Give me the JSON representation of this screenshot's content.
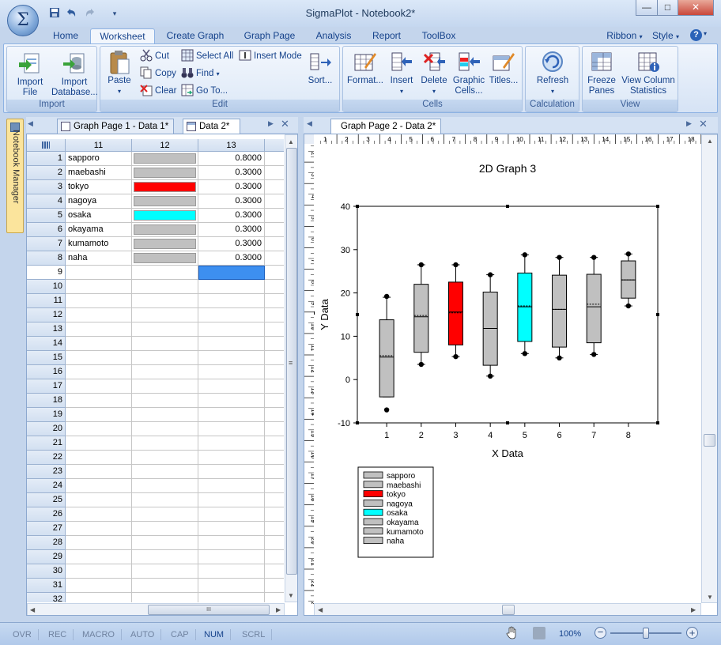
{
  "window": {
    "title": "SigmaPlot - Notebook2*"
  },
  "app_button": {
    "glyph": "Σ"
  },
  "quick_access": [
    {
      "icon": "save-icon"
    },
    {
      "icon": "undo-icon"
    },
    {
      "icon": "redo-icon"
    },
    {
      "icon": "customize-arrow-icon"
    }
  ],
  "window_controls": {
    "minimize": "—",
    "maximize": "□",
    "close": "✕"
  },
  "ribbon": {
    "tabs": [
      {
        "label": "Home",
        "active": false
      },
      {
        "label": "Worksheet",
        "active": true
      },
      {
        "label": "Create Graph",
        "active": false
      },
      {
        "label": "Graph Page",
        "active": false
      },
      {
        "label": "Analysis",
        "active": false
      },
      {
        "label": "Report",
        "active": false
      },
      {
        "label": "ToolBox",
        "active": false
      }
    ],
    "right": {
      "ribbon_label": "Ribbon",
      "style_label": "Style",
      "help_icon": "help-icon"
    },
    "groups": {
      "import": {
        "caption": "Import",
        "import_file": "Import\nFile",
        "import_database": "Import\nDatabase..."
      },
      "edit": {
        "caption": "Edit",
        "paste": "Paste",
        "cut": "Cut",
        "copy": "Copy",
        "clear": "Clear",
        "select_all": "Select All",
        "find": "Find",
        "goto": "Go To...",
        "insert_mode": "Insert Mode",
        "sort": "Sort..."
      },
      "cells": {
        "caption": "Cells",
        "format": "Format...",
        "insert": "Insert",
        "delete": "Delete",
        "graphic_cells": "Graphic\nCells...",
        "titles": "Titles..."
      },
      "calculation": {
        "caption": "Calculation",
        "refresh": "Refresh"
      },
      "view": {
        "caption": "View",
        "freeze_panes": "Freeze\nPanes",
        "view_column_statistics": "View Column\nStatistics"
      }
    }
  },
  "notebook_manager": {
    "label": "Notebook Manager"
  },
  "left_pane": {
    "tabs": [
      {
        "label": "Graph Page 1 - Data 1*",
        "active": false
      },
      {
        "label": "Data 2*",
        "active": true
      }
    ],
    "columns": [
      "11",
      "12",
      "13"
    ],
    "rows": [
      {
        "n": "1",
        "name": "sapporo",
        "color": "#c0c0c0",
        "value": "0.8000"
      },
      {
        "n": "2",
        "name": "maebashi",
        "color": "#c0c0c0",
        "value": "0.3000"
      },
      {
        "n": "3",
        "name": "tokyo",
        "color": "#ff0000",
        "value": "0.3000"
      },
      {
        "n": "4",
        "name": "nagoya",
        "color": "#c0c0c0",
        "value": "0.3000"
      },
      {
        "n": "5",
        "name": "osaka",
        "color": "#00ffff",
        "value": "0.3000"
      },
      {
        "n": "6",
        "name": "okayama",
        "color": "#c0c0c0",
        "value": "0.3000"
      },
      {
        "n": "7",
        "name": "kumamoto",
        "color": "#c0c0c0",
        "value": "0.3000"
      },
      {
        "n": "8",
        "name": "naha",
        "color": "#c0c0c0",
        "value": "0.3000"
      }
    ],
    "empty_rows": [
      "9",
      "10",
      "11",
      "12",
      "13",
      "14",
      "15",
      "16",
      "17",
      "18",
      "19",
      "20",
      "21",
      "22",
      "23",
      "24",
      "25",
      "26",
      "27",
      "28",
      "29",
      "30",
      "31",
      "32"
    ],
    "hscroll_grip": "III"
  },
  "right_pane": {
    "tab": {
      "label": "Graph Page 2 - Data 2*"
    },
    "ruler_labels": [
      "1",
      "2",
      "3",
      "4",
      "5",
      "6",
      "7",
      "8",
      "9",
      "10",
      "11",
      "12",
      "13",
      "14",
      "15",
      "16",
      "17",
      "18"
    ],
    "vruler_labels": [
      "2",
      "3",
      "4",
      "5",
      "6",
      "7",
      "8",
      "9",
      "10",
      "11",
      "12",
      "13",
      "14",
      "15",
      "16",
      "17",
      "18",
      "19",
      "20",
      "21",
      "22",
      "23",
      "24",
      "25",
      "26"
    ]
  },
  "chart_data": {
    "type": "box",
    "title": "2D Graph 3",
    "xlabel": "X Data",
    "ylabel": "Y Data",
    "ylim": [
      -10,
      40
    ],
    "yticks": [
      -10,
      0,
      10,
      20,
      30,
      40
    ],
    "xlim": [
      0.15,
      8.85
    ],
    "categories": [
      "1",
      "2",
      "3",
      "4",
      "5",
      "6",
      "7",
      "8"
    ],
    "boxes": [
      {
        "x": 1,
        "whisker_low": -4,
        "q1": -4,
        "median": 5.2,
        "mean": 5.5,
        "q3": 13.8,
        "whisker_high": 19,
        "outliers": [
          -7,
          19.2
        ],
        "color": "#c0c0c0"
      },
      {
        "x": 2,
        "whisker_low": 3.5,
        "q1": 6.3,
        "median": 14.5,
        "mean": 14.8,
        "q3": 22,
        "whisker_high": 26.5,
        "outliers": [
          3.5,
          26.5
        ],
        "color": "#c0c0c0"
      },
      {
        "x": 3,
        "whisker_low": 5.3,
        "q1": 8,
        "median": 15.6,
        "mean": 15.4,
        "q3": 22.5,
        "whisker_high": 26.5,
        "outliers": [
          5.3,
          26.5
        ],
        "color": "#ff0000"
      },
      {
        "x": 4,
        "whisker_low": 0.8,
        "q1": 3.3,
        "median": 11.8,
        "mean": 11.8,
        "q3": 20.2,
        "whisker_high": 24.2,
        "outliers": [
          0.8,
          24.2
        ],
        "color": "#c0c0c0"
      },
      {
        "x": 5,
        "whisker_low": 6,
        "q1": 8.8,
        "median": 16.8,
        "mean": 17,
        "q3": 24.6,
        "whisker_high": 28.8,
        "outliers": [
          6,
          28.8
        ],
        "color": "#00ffff"
      },
      {
        "x": 6,
        "whisker_low": 5,
        "q1": 7.5,
        "median": 16.2,
        "mean": 16.2,
        "q3": 24.1,
        "whisker_high": 28.2,
        "outliers": [
          5,
          28.2
        ],
        "color": "#c0c0c0"
      },
      {
        "x": 7,
        "whisker_low": 5.8,
        "q1": 8.5,
        "median": 16.8,
        "mean": 17.4,
        "q3": 24.3,
        "whisker_high": 28.2,
        "outliers": [
          5.8,
          28.2
        ],
        "color": "#c0c0c0"
      },
      {
        "x": 8,
        "whisker_low": 17,
        "q1": 18.8,
        "median": 23,
        "mean": 23,
        "q3": 27.4,
        "whisker_high": 29,
        "outliers": [
          17,
          29
        ],
        "color": "#c0c0c0"
      }
    ],
    "legend": {
      "placement": "bottom-left",
      "entries": [
        {
          "label": "sapporo",
          "color": "#c0c0c0"
        },
        {
          "label": "maebashi",
          "color": "#c0c0c0"
        },
        {
          "label": "tokyo",
          "color": "#ff0000"
        },
        {
          "label": "nagoya",
          "color": "#c0c0c0"
        },
        {
          "label": "osaka",
          "color": "#00ffff"
        },
        {
          "label": "okayama",
          "color": "#c0c0c0"
        },
        {
          "label": "kumamoto",
          "color": "#c0c0c0"
        },
        {
          "label": "naha",
          "color": "#c0c0c0"
        }
      ]
    }
  },
  "statusbar": {
    "indicators": [
      {
        "label": "OVR",
        "on": false
      },
      {
        "label": "REC",
        "on": false
      },
      {
        "label": "MACRO",
        "on": false
      },
      {
        "label": "AUTO",
        "on": false
      },
      {
        "label": "CAP",
        "on": false
      },
      {
        "label": "NUM",
        "on": true
      },
      {
        "label": "SCRL",
        "on": false
      }
    ],
    "zoom": "100%",
    "zoom_level": 1.0
  }
}
